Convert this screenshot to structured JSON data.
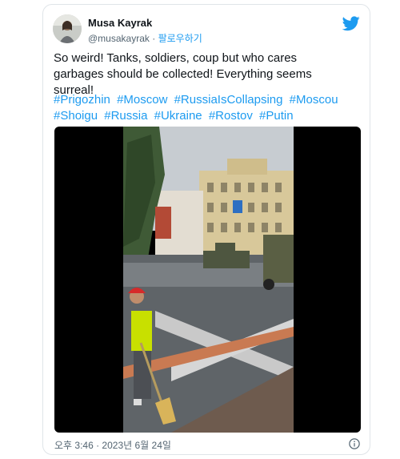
{
  "tweet": {
    "author_name": "Musa Kayrak",
    "handle": "@musakayrak",
    "separator": "·",
    "follow_label": "팔로우하기",
    "text": "So weird! Tanks, soldiers, coup but who cares garbages should be collected! Everything seems surreal!",
    "hashtags": [
      "#Prigozhin",
      "#Moscow",
      "#RussiaIsCollapsing",
      "#Moscou",
      "#Shoigu",
      "#Russia",
      "#Ukraine",
      "#Rostov",
      "#Putin"
    ],
    "timestamp": "오후 3:46 · 2023년 6월 24일"
  },
  "icons": {
    "brand": "twitter-bird-icon",
    "info": "info-icon"
  },
  "colors": {
    "link": "#1d9bf0",
    "text": "#0f1419",
    "muted": "#536471",
    "vest": "#c8e000",
    "cap": "#d62a2a"
  }
}
